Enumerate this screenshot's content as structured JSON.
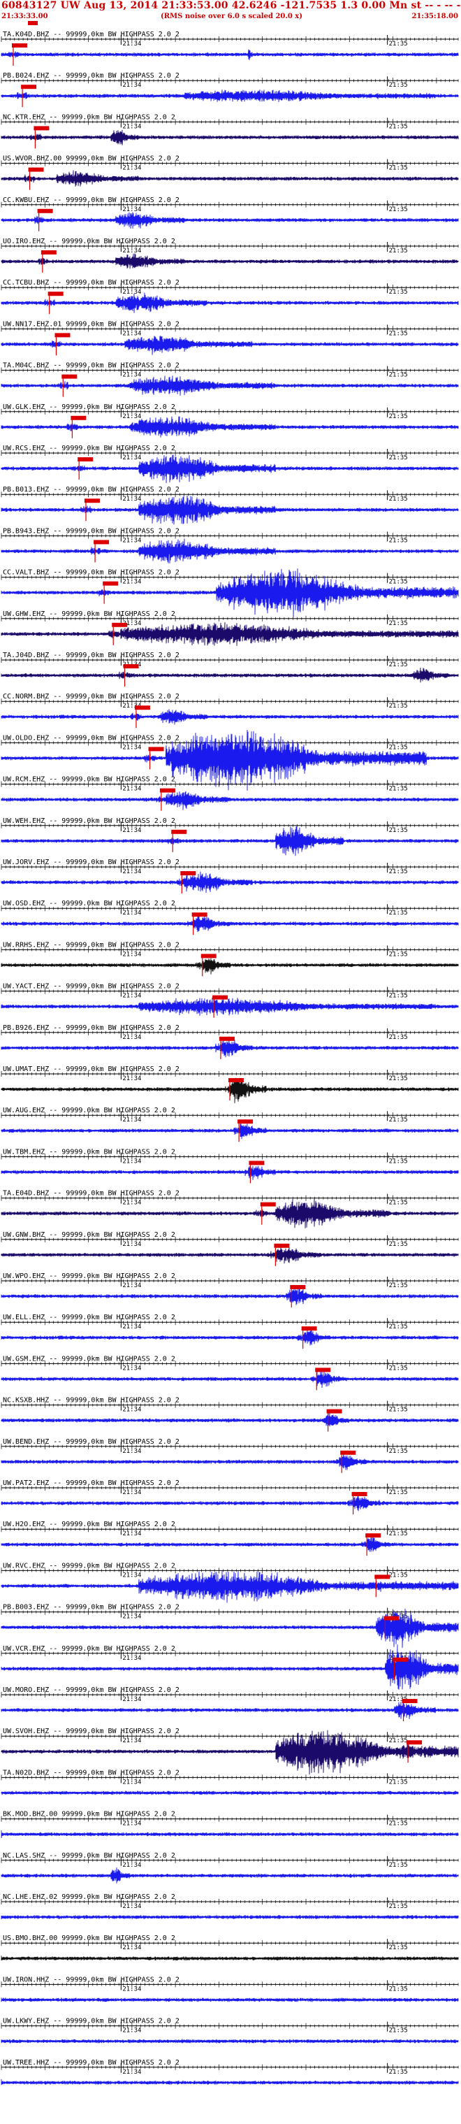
{
  "header": {
    "title": "60843127 UW Aug 13, 2014 21:33:53.00   42.6246 -121.7535  1.3 0.00 Mn st -- - -- -   -1",
    "start_time": "21:33:33.00",
    "end_time": "21:35:18.00",
    "note": "(RMS noise over 6.0 s scaled 20.0 x)"
  },
  "colors": {
    "trace_blue": "#1a1aee",
    "trace_navy": "#1c0a6a",
    "trace_black": "#111111",
    "pick_red": "#dd0000",
    "label_text": "#000000",
    "axis": "#000000"
  },
  "chart_data": {
    "type": "line",
    "title": "60843127 UW Aug 13, 2014 21:33:53.00   42.6246 -121.7535  1.3 0.00 Mn st -- - -- -   -1",
    "x_range": [
      "21:33:33.00",
      "21:35:18.00"
    ],
    "time_labels": [
      "21:34",
      "21:35"
    ],
    "series": [
      {
        "name": "TA.K04D.BHZ.--",
        "text": "TA.K04D.BHZ -- 99999.0km BW  HIGHPASS  2.0  2",
        "color": "trace_blue",
        "pick": 0.026,
        "event": [
          0.54,
          0.55
        ],
        "amp": 0.8
      },
      {
        "name": "PB.B024.EHZ.--",
        "text": "PB.B024.EHZ -- 99999.0km BW  HIGHPASS  2.0  2",
        "color": "trace_blue",
        "pick": 0.046,
        "event": [
          0.4,
          0.95
        ],
        "amp": 0.7
      },
      {
        "name": "NC.KTR.EHZ.--",
        "text": "NC.KTR.EHZ -- 99999.0km BW  HIGHPASS  2.0  2",
        "color": "trace_navy",
        "pick": 0.074,
        "event": [
          0.24,
          0.3
        ],
        "amp": 1.0
      },
      {
        "name": "US.WVOR.BHZ.00",
        "text": "US.WVOR.BHZ.00 99999.0km BW  HIGHPASS  2.0  2",
        "color": "trace_navy",
        "pick": 0.062,
        "event": [
          0.12,
          0.3
        ],
        "amp": 0.9
      },
      {
        "name": "CC.KWBU.EHZ.--",
        "text": "CC.KWBU.EHZ -- 99999.0km BW  HIGHPASS  2.0  2",
        "color": "trace_blue",
        "pick": 0.082,
        "event": [
          0.25,
          0.4
        ],
        "amp": 1.0
      },
      {
        "name": "UO.IRO.EHZ.--",
        "text": "UO.IRO.EHZ -- 99999.0km BW  HIGHPASS  2.0  2",
        "color": "trace_navy",
        "pick": 0.09,
        "event": [
          0.25,
          0.4
        ],
        "amp": 1.0
      },
      {
        "name": "CC.TCBU.BHZ.--",
        "text": "CC.TCBU.BHZ -- 99999.0km BW  HIGHPASS  2.0  2",
        "color": "trace_blue",
        "pick": 0.105,
        "event": [
          0.25,
          0.45
        ],
        "amp": 1.2
      },
      {
        "name": "UW.NN17.EHZ.01",
        "text": "UW.NN17.EHZ.01 99999.0km BW  HIGHPASS  2.0  2",
        "color": "trace_blue",
        "pick": 0.12,
        "event": [
          0.27,
          0.55
        ],
        "amp": 1.1
      },
      {
        "name": "TA.M04C.BHZ.--",
        "text": "TA.M04C.BHZ -- 99999.0km BW  HIGHPASS  2.0  2",
        "color": "trace_blue",
        "pick": 0.135,
        "event": [
          0.28,
          0.6
        ],
        "amp": 1.2
      },
      {
        "name": "UW.GLK.EHZ.--",
        "text": "UW.GLK.EHZ -- 99999.0km BW  HIGHPASS  2.0  2",
        "color": "trace_blue",
        "pick": 0.155,
        "event": [
          0.28,
          0.6
        ],
        "amp": 1.3
      },
      {
        "name": "UW.RCS.EHZ.--",
        "text": "UW.RCS.EHZ -- 99999.0km BW  HIGHPASS  2.0  2",
        "color": "trace_blue",
        "pick": 0.17,
        "event": [
          0.3,
          0.6
        ],
        "amp": 1.8
      },
      {
        "name": "PB.B013.EHZ.--",
        "text": "PB.B013.EHZ -- 99999.0km BW  HIGHPASS  2.0  2",
        "color": "trace_blue",
        "pick": 0.185,
        "event": [
          0.3,
          0.6
        ],
        "amp": 2.0
      },
      {
        "name": "PB.B943.EHZ.--",
        "text": "PB.B943.EHZ -- 99999.0km BW  HIGHPASS  2.0  2",
        "color": "trace_blue",
        "pick": 0.205,
        "event": [
          0.3,
          0.6
        ],
        "amp": 1.6
      },
      {
        "name": "CC.VALT.BHZ.--",
        "text": "CC.VALT.BHZ -- 99999.0km BW  HIGHPASS  2.0  2",
        "color": "trace_blue",
        "pick": 0.225,
        "event": [
          0.47,
          1.0
        ],
        "amp": 3.0
      },
      {
        "name": "UW.GHW.EHZ.--",
        "text": "UW.GHW.EHZ -- 99999.0km BW  HIGHPASS  2.0  2",
        "color": "trace_navy",
        "pick": 0.245,
        "event": [
          0.26,
          1.0
        ],
        "amp": 1.4
      },
      {
        "name": "TA.J04D.BHZ.--",
        "text": "TA.J04D.BHZ -- 99999.0km BW  HIGHPASS  2.0  2",
        "color": "trace_navy",
        "pick": 0.27,
        "event": [
          0.9,
          0.98
        ],
        "amp": 0.9
      },
      {
        "name": "CC.NORM.BHZ.--",
        "text": "CC.NORM.BHZ -- 99999.0km BW  HIGHPASS  2.0  2",
        "color": "trace_blue",
        "pick": 0.295,
        "event": [
          0.35,
          0.45
        ],
        "amp": 1.0
      },
      {
        "name": "UW.OLDO.EHZ.--",
        "text": "UW.OLDO.EHZ -- 99999.0km BW  HIGHPASS  2.0  2",
        "color": "trace_blue",
        "pick": 0.325,
        "event": [
          0.36,
          0.93
        ],
        "amp": 4.0
      },
      {
        "name": "UW.RCM.EHZ.--",
        "text": "UW.RCM.EHZ -- 99999.0km BW  HIGHPASS  2.0  2",
        "color": "trace_blue",
        "pick": 0.35,
        "event": [
          0.36,
          0.5
        ],
        "amp": 1.2
      },
      {
        "name": "UW.WEH.EHZ.--",
        "text": "UW.WEH.EHZ -- 99999.0km BW  HIGHPASS  2.0  2",
        "color": "trace_blue",
        "pick": 0.375,
        "event": [
          0.6,
          0.75
        ],
        "amp": 2.0
      },
      {
        "name": "UW.JORV.EHZ.--",
        "text": "UW.JORV.EHZ -- 99999.0km BW  HIGHPASS  2.0  2",
        "color": "trace_blue",
        "pick": 0.395,
        "event": [
          0.4,
          0.55
        ],
        "amp": 1.3
      },
      {
        "name": "UW.OSD.EHZ.--",
        "text": "UW.OSD.EHZ -- 99999.0km BW  HIGHPASS  2.0  2",
        "color": "trace_blue",
        "pick": 0.42,
        "event": [
          0.42,
          0.5
        ],
        "amp": 1.0
      },
      {
        "name": "UW.RRHS.EHZ.--",
        "text": "UW.RRHS.EHZ -- 99999.0km BW  HIGHPASS  2.0  2",
        "color": "trace_black",
        "pick": 0.44,
        "event": [
          0.44,
          0.5
        ],
        "amp": 1.0
      },
      {
        "name": "UW.YACT.EHZ.--",
        "text": "UW.YACT.EHZ -- 99999.0km BW  HIGHPASS  2.0  2",
        "color": "trace_blue",
        "pick": 0.465,
        "event": [
          0.3,
          0.95
        ],
        "amp": 1.0
      },
      {
        "name": "PB.B926.EHZ.--",
        "text": "PB.B926.EHZ -- 99999.0km BW  HIGHPASS  2.0  2",
        "color": "trace_blue",
        "pick": 0.48,
        "event": [
          0.48,
          0.55
        ],
        "amp": 1.2
      },
      {
        "name": "UW.UMAT.EHZ.--",
        "text": "UW.UMAT.EHZ -- 99999.0km BW  HIGHPASS  2.0  2",
        "color": "trace_black",
        "pick": 0.5,
        "event": [
          0.5,
          0.58
        ],
        "amp": 1.6
      },
      {
        "name": "UW.AUG.EHZ.--",
        "text": "UW.AUG.EHZ -- 99999.0km BW  HIGHPASS  2.0  2",
        "color": "trace_blue",
        "pick": 0.52,
        "event": [
          0.52,
          0.58
        ],
        "amp": 1.0
      },
      {
        "name": "UW.TBM.EHZ.--",
        "text": "UW.TBM.EHZ -- 99999.0km BW  HIGHPASS  2.0  2",
        "color": "trace_blue",
        "pick": 0.545,
        "event": [
          0.54,
          0.6
        ],
        "amp": 1.0
      },
      {
        "name": "TA.E04D.BHZ.--",
        "text": "TA.E04D.BHZ -- 99999.0km BW  HIGHPASS  2.0  2",
        "color": "trace_navy",
        "pick": 0.57,
        "event": [
          0.6,
          0.85
        ],
        "amp": 1.8
      },
      {
        "name": "UW.GNW.BHZ.--",
        "text": "UW.GNW.BHZ -- 99999.0km BW  HIGHPASS  2.0  2",
        "color": "trace_navy",
        "pick": 0.6,
        "event": [
          0.6,
          0.7
        ],
        "amp": 1.0
      },
      {
        "name": "UW.WPO.EHZ.--",
        "text": "UW.WPO.EHZ -- 99999.0km BW  HIGHPASS  2.0  2",
        "color": "trace_blue",
        "pick": 0.635,
        "event": [
          0.63,
          0.7
        ],
        "amp": 1.0
      },
      {
        "name": "UW.ELL.EHZ.--",
        "text": "UW.ELL.EHZ -- 99999.0km BW  HIGHPASS  2.0  2",
        "color": "trace_blue",
        "pick": 0.66,
        "event": [
          0.66,
          0.72
        ],
        "amp": 1.0
      },
      {
        "name": "UW.GSM.EHZ.--",
        "text": "UW.GSM.EHZ -- 99999.0km BW  HIGHPASS  2.0  2",
        "color": "trace_blue",
        "pick": 0.69,
        "event": [
          0.69,
          0.75
        ],
        "amp": 1.0
      },
      {
        "name": "NC.KSXB.HHZ.--",
        "text": "NC.KSXB.HHZ -- 99999.0km BW  HIGHPASS  2.0  2",
        "color": "trace_blue",
        "pick": 0.715,
        "event": [
          0.71,
          0.76
        ],
        "amp": 0.9
      },
      {
        "name": "UW.BEND.EHZ.--",
        "text": "UW.BEND.EHZ -- 99999.0km BW  HIGHPASS  2.0  2",
        "color": "trace_blue",
        "pick": 0.745,
        "event": [
          0.74,
          0.8
        ],
        "amp": 1.0
      },
      {
        "name": "UW.PAT2.EHZ.--",
        "text": "UW.PAT2.EHZ -- 99999.0km BW  HIGHPASS  2.0  2",
        "color": "trace_blue",
        "pick": 0.77,
        "event": [
          0.77,
          0.83
        ],
        "amp": 1.0
      },
      {
        "name": "UW.H2O.EHZ.--",
        "text": "UW.H2O.EHZ -- 99999.0km BW  HIGHPASS  2.0  2",
        "color": "trace_blue",
        "pick": 0.8,
        "event": [
          0.8,
          0.85
        ],
        "amp": 1.0
      },
      {
        "name": "UW.RVC.EHZ.--",
        "text": "UW.RVC.EHZ -- 99999.0km BW  HIGHPASS  2.0  2",
        "color": "trace_blue",
        "pick": 0.82,
        "event": [
          0.3,
          1.0
        ],
        "amp": 2.0
      },
      {
        "name": "PB.B003.EHZ.--",
        "text": "PB.B003.EHZ -- 99999.0km BW  HIGHPASS  2.0  2",
        "color": "trace_blue",
        "pick": 0.84,
        "event": [
          0.82,
          1.0
        ],
        "amp": 2.5
      },
      {
        "name": "UW.VCR.EHZ.--",
        "text": "UW.VCR.EHZ -- 99999.0km BW  HIGHPASS  2.0  2",
        "color": "trace_blue",
        "pick": 0.86,
        "event": [
          0.84,
          1.0
        ],
        "amp": 3.2
      },
      {
        "name": "UW.MORO.EHZ.--",
        "text": "UW.MORO.EHZ -- 99999.0km BW  HIGHPASS  2.0  2",
        "color": "trace_blue",
        "pick": 0.88,
        "event": [
          0.86,
          0.95
        ],
        "amp": 1.0
      },
      {
        "name": "UW.SVOH.EHZ.--",
        "text": "UW.SVOH.EHZ -- 99999.0km BW  HIGHPASS  2.0  2",
        "color": "trace_navy",
        "pick": 0.89,
        "event": [
          0.6,
          1.0
        ],
        "amp": 3.0
      },
      {
        "name": "TA.N02D.BHZ.--",
        "text": "TA.N02D.BHZ -- 99999.0km BW  HIGHPASS  2.0  2",
        "color": "trace_blue",
        "pick": null,
        "event": [
          0.0,
          0.0
        ],
        "amp": 0.0
      },
      {
        "name": "BK.MOD.BHZ.00",
        "text": "BK.MOD.BHZ.00 99999.0km BW  HIGHPASS  2.0  2",
        "color": "trace_blue",
        "pick": null,
        "event": [
          0.0,
          0.0
        ],
        "amp": 0.8
      },
      {
        "name": "NC.LAS.SHZ.--",
        "text": "NC.LAS.SHZ -- 99999.0km BW  HIGHPASS  2.0  2",
        "color": "trace_blue",
        "pick": null,
        "event": [
          0.24,
          0.28
        ],
        "amp": 1.0
      },
      {
        "name": "NC.LHE.EHZ.02",
        "text": "NC.LHE.EHZ.02 99999.0km BW  HIGHPASS  2.0  2",
        "color": "trace_blue",
        "pick": null,
        "event": [
          0.0,
          0.0
        ],
        "amp": 0.9
      },
      {
        "name": "US.BMO.BHZ.00",
        "text": "US.BMO.BHZ.00 99999.0km BW  HIGHPASS  2.0  2",
        "color": "trace_black",
        "pick": null,
        "event": [
          0.0,
          0.0
        ],
        "amp": 0.9
      },
      {
        "name": "UW.IRON.HHZ.--",
        "text": "UW.IRON.HHZ -- 99999.0km BW  HIGHPASS  2.0  2",
        "color": "trace_blue",
        "pick": null,
        "event": [
          0.0,
          0.0
        ],
        "amp": 0.9
      },
      {
        "name": "UW.LKWY.EHZ.--",
        "text": "UW.LKWY.EHZ -- 99999.0km BW  HIGHPASS  2.0  2",
        "color": "trace_blue",
        "pick": null,
        "event": [
          0.0,
          0.0
        ],
        "amp": 0.9
      },
      {
        "name": "UW.TREE.HHZ.--",
        "text": "UW.TREE.HHZ -- 99999.0km BW  HIGHPASS  2.0  2",
        "color": "trace_blue",
        "pick": null,
        "event": [
          0.0,
          0.0
        ],
        "amp": 0.9
      }
    ]
  }
}
